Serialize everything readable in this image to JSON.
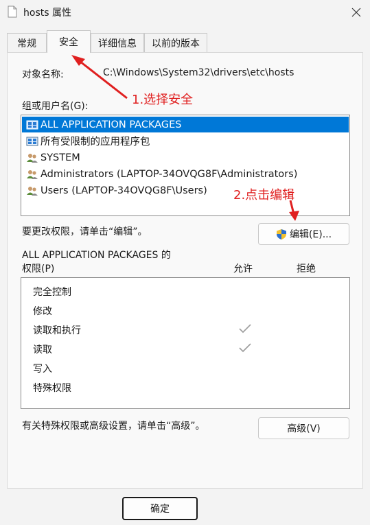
{
  "window": {
    "title": "hosts 属性",
    "close_glyph": "✕"
  },
  "tabs": [
    {
      "label": "常规"
    },
    {
      "label": "安全"
    },
    {
      "label": "详细信息"
    },
    {
      "label": "以前的版本"
    }
  ],
  "security": {
    "object_label": "对象名称:",
    "object_value": "C:\\Windows\\System32\\drivers\\etc\\hosts",
    "group_label": "组或用户名(G):",
    "users": [
      {
        "name": "ALL APPLICATION PACKAGES"
      },
      {
        "name": "所有受限制的应用程序包"
      },
      {
        "name": "SYSTEM"
      },
      {
        "name": "Administrators (LAPTOP-34OVQG8F\\Administrators)"
      },
      {
        "name": "Users (LAPTOP-34OVQG8F\\Users)"
      }
    ],
    "change_hint": "要更改权限，请单击“编辑”。",
    "edit_button": "编辑(E)...",
    "perm_title_line1": "ALL APPLICATION PACKAGES 的",
    "perm_title_line2": "权限(P)",
    "allow_col": "允许",
    "deny_col": "拒绝",
    "permissions": [
      {
        "name": "完全控制",
        "allow": false
      },
      {
        "name": "修改",
        "allow": false
      },
      {
        "name": "读取和执行",
        "allow": true
      },
      {
        "name": "读取",
        "allow": true
      },
      {
        "name": "写入",
        "allow": false
      },
      {
        "name": "特殊权限",
        "allow": false
      }
    ],
    "advanced_hint": "有关特殊权限或高级设置，请单击“高级”。",
    "advanced_button": "高级(V)"
  },
  "footer": {
    "ok_button": "确定"
  },
  "annotations": {
    "step1": "1.选择安全",
    "step2": "2.点击编辑",
    "color": "#e02020"
  },
  "colors": {
    "selection": "#0078d7",
    "window_bg": "#f3f3f3"
  },
  "icons": {
    "file": "file-icon",
    "close": "close-icon",
    "package": "package-icon",
    "users": "users-icon",
    "shield": "uac-shield-icon",
    "check": "check-icon"
  }
}
